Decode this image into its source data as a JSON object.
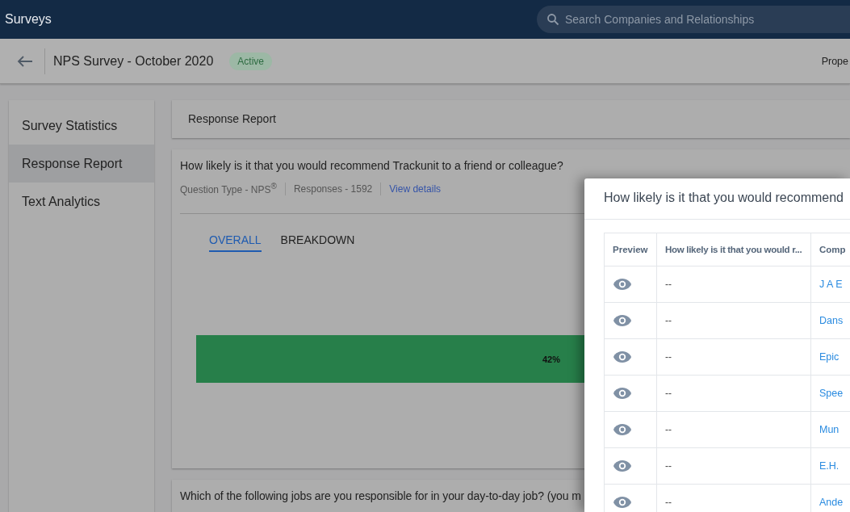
{
  "app_bar": {
    "title": "Surveys",
    "search": {
      "placeholder": "Search Companies and Relationships"
    }
  },
  "survey_header": {
    "title": "NPS Survey - October 2020",
    "status": "Active",
    "right_tab": "Prope"
  },
  "sidebar": {
    "items": [
      {
        "label": "Survey Statistics",
        "selected": false
      },
      {
        "label": "Response Report",
        "selected": true
      },
      {
        "label": "Text Analytics",
        "selected": false
      }
    ]
  },
  "report_header": {
    "title": "Response Report"
  },
  "question_card": {
    "question": "How likely is it that you would recommend Trackunit to a friend or colleague?",
    "question_type": "Question Type - NPS$^{®}$",
    "responses": "Responses - 1592",
    "details_link": "View details",
    "tabs": [
      {
        "label": "OVERALL",
        "selected": true
      },
      {
        "label": "BREAKDOWN",
        "selected": false
      }
    ],
    "bar": {
      "segments": [
        {
          "label": "42%",
          "color": "#277f4a"
        }
      ]
    }
  },
  "next_question": {
    "question": "Which of the following jobs are you responsible for in your day-to-day job? (you m"
  },
  "drawer": {
    "title": "How likely is it that you would recommend",
    "columns": [
      "Preview",
      "How likely is it that you would r...",
      "Comp"
    ],
    "rows": [
      {
        "answer": "--",
        "company": "J A E"
      },
      {
        "answer": "--",
        "company": "Dans"
      },
      {
        "answer": "--",
        "company": "Epic"
      },
      {
        "answer": "--",
        "company": "Spee"
      },
      {
        "answer": "--",
        "company": "Mun"
      },
      {
        "answer": "--",
        "company": "E.H."
      },
      {
        "answer": "--",
        "company": "Ande"
      }
    ]
  }
}
